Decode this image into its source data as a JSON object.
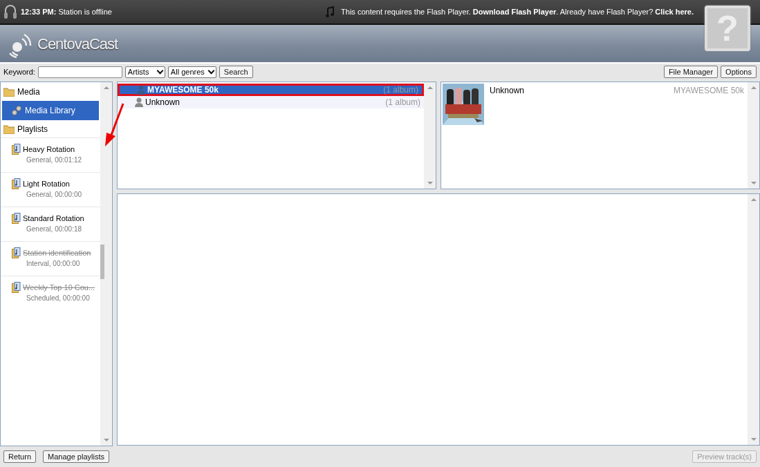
{
  "status_bar": {
    "time": "12:33 PM:",
    "status": "Station is offline",
    "flash_notice": "This content requires the Flash Player. **Download Flash Player**. Already have Flash Player? **Click here.**",
    "flash_placeholder": "?"
  },
  "brand": {
    "name": "CentovaCast"
  },
  "toolbar": {
    "keyword_label": "Keyword:",
    "filter": "Artists",
    "genre": "All genres",
    "search_button": "Search",
    "right_buttons": [
      "File Manager",
      "Options"
    ]
  },
  "sidebar": {
    "items": [
      {
        "kind": "group",
        "label": "Media"
      },
      {
        "kind": "link",
        "label": "Media Library",
        "selected": true
      },
      {
        "kind": "group",
        "label": "Playlists"
      },
      {
        "kind": "playlist",
        "label": "Heavy Rotation",
        "detail": "General, 00:01:12",
        "disabled": false,
        "selected": false
      },
      {
        "kind": "playlist",
        "label": "Light Rotation",
        "detail": "General, 00:00:00",
        "disabled": false,
        "selected": false
      },
      {
        "kind": "playlist",
        "label": "Standard Rotation",
        "detail": "General, 00:00:18",
        "disabled": false,
        "selected": false
      },
      {
        "kind": "playlist",
        "label": "Station identification",
        "detail": "Interval, 00:00:00",
        "disabled": true,
        "selected": false
      },
      {
        "kind": "playlist",
        "label": "Weekly Top 10 Cou...",
        "detail": "Scheduled, 00:00:00",
        "disabled": true,
        "selected": false
      }
    ]
  },
  "artists": [
    {
      "name": "MYAWESOME 50k",
      "count": "(1 album)",
      "selected": true
    },
    {
      "name": "Unknown",
      "count": "(1 album)",
      "selected": false
    }
  ],
  "albums": [
    {
      "kind": "picture",
      "title": "Unknown",
      "artist": "MYAWESOME 50k"
    }
  ],
  "footer": {
    "buttons": [
      {
        "label": "Return",
        "disabled": false
      },
      {
        "label": "Manage playlists",
        "disabled": false
      }
    ],
    "preview": {
      "label": "Preview track(s)",
      "disabled": true
    }
  }
}
